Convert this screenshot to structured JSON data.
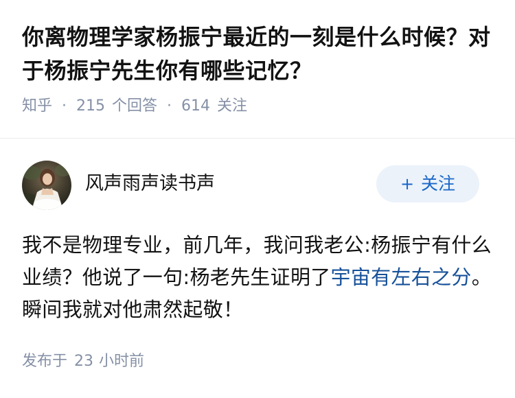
{
  "question": {
    "title": "你离物理学家杨振宁最近的一刻是什么时候？对于杨振宁先生你有哪些记忆？",
    "source": "知乎",
    "separator": "·",
    "answer_count": "215",
    "answer_label": "个回答",
    "follower_count": "614",
    "follower_label": "关注"
  },
  "answer": {
    "author_name": "风声雨声读书声",
    "follow_plus": "+",
    "follow_label": "关注",
    "content_before": "我不是物理专业，前几年，我问我老公:杨振宁有什么业绩？他说了一句:杨老先生证明了",
    "content_link": "宇宙有左右之分",
    "content_after": "。瞬间我就对他肃然起敬！",
    "published_label": "发布于",
    "published_num": "23",
    "published_unit": "小时前"
  },
  "colors": {
    "meta_gray": "#8590a6",
    "link_blue": "#175199",
    "follow_blue": "#1a66c9",
    "follow_bg": "#ebf2fa"
  },
  "icons": {
    "avatar": "avatar-photo-woman-in-white-dress"
  }
}
